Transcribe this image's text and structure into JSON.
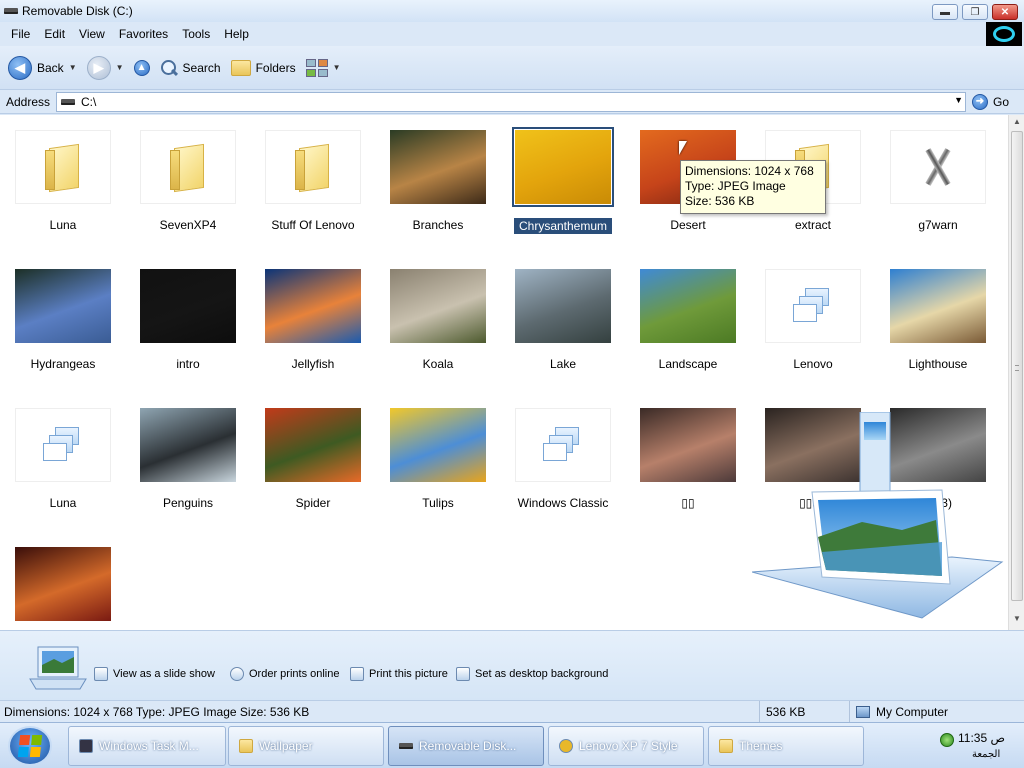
{
  "window": {
    "title": "Removable Disk (C:)",
    "buttons": {
      "minimize": "▬",
      "maximize": "❐",
      "close": "✕"
    }
  },
  "menu": [
    "File",
    "Edit",
    "View",
    "Favorites",
    "Tools",
    "Help"
  ],
  "toolbar": {
    "back": "Back",
    "search": "Search",
    "folders": "Folders"
  },
  "address": {
    "label": "Address",
    "value": "C:\\",
    "go": "Go"
  },
  "items": [
    {
      "name": "Luna",
      "kind": "folder"
    },
    {
      "name": "SevenXP4",
      "kind": "folder"
    },
    {
      "name": "Stuff Of Lenovo",
      "kind": "folder"
    },
    {
      "name": "Branches",
      "kind": "image",
      "colors": [
        "#2a3b24",
        "#b88446",
        "#3d2a18"
      ]
    },
    {
      "name": "Chrysanthemum",
      "kind": "image",
      "colors": [
        "#f0c21a",
        "#e3a40c",
        "#c98b06"
      ],
      "selected": true
    },
    {
      "name": "Desert",
      "kind": "image",
      "colors": [
        "#e36a1e",
        "#c6441a",
        "#7a2412"
      ]
    },
    {
      "name": "extract",
      "kind": "folder"
    },
    {
      "name": "g7warn",
      "kind": "tools"
    },
    {
      "name": "Hydrangeas",
      "kind": "image",
      "colors": [
        "#1c2f26",
        "#5b7fc4",
        "#3a5c94"
      ]
    },
    {
      "name": "intro",
      "kind": "image",
      "colors": [
        "#111111",
        "#151515",
        "#0d0d0d"
      ]
    },
    {
      "name": "Jellyfish",
      "kind": "image",
      "colors": [
        "#0b3478",
        "#e8823a",
        "#1a5bb0"
      ]
    },
    {
      "name": "Koala",
      "kind": "image",
      "colors": [
        "#8a8170",
        "#c9c1af",
        "#4d5a2e"
      ]
    },
    {
      "name": "Lake",
      "kind": "image",
      "colors": [
        "#9fb3c4",
        "#5d6a70",
        "#34403f"
      ]
    },
    {
      "name": "Landscape",
      "kind": "image",
      "colors": [
        "#3f8ad6",
        "#6f9a3a",
        "#4c7a24"
      ]
    },
    {
      "name": "Lenovo",
      "kind": "theme"
    },
    {
      "name": "Lighthouse",
      "kind": "image",
      "colors": [
        "#2e7fd1",
        "#e6d7a8",
        "#7a5a36"
      ]
    },
    {
      "name": "Luna",
      "kind": "theme"
    },
    {
      "name": "Penguins",
      "kind": "image",
      "colors": [
        "#8fa5b2",
        "#2a2f33",
        "#c9d6de"
      ]
    },
    {
      "name": "Spider",
      "kind": "image",
      "colors": [
        "#c23a1a",
        "#3e5a22",
        "#e86a28"
      ]
    },
    {
      "name": "Tulips",
      "kind": "image",
      "colors": [
        "#f2c82a",
        "#4d8ed6",
        "#e8a41c"
      ]
    },
    {
      "name": "Windows Classic",
      "kind": "theme"
    },
    {
      "name": "▯▯",
      "kind": "image",
      "colors": [
        "#3a2a26",
        "#b7806a",
        "#4d3a3a"
      ]
    },
    {
      "name": "▯▯(2)",
      "kind": "image",
      "colors": [
        "#2a2320",
        "#8a7060",
        "#3d3330"
      ]
    },
    {
      "name": "▯▯(3)",
      "kind": "image",
      "colors": [
        "#2a2a2a",
        "#8a8a8a",
        "#444"
      ]
    },
    {
      "name": "",
      "kind": "image",
      "colors": [
        "#3a0e0a",
        "#d46a2a",
        "#7a1a12"
      ]
    }
  ],
  "tooltip": {
    "line1": "Dimensions: 1024 x 768",
    "line2": "Type: JPEG Image",
    "line3": "Size: 536 KB"
  },
  "tasks": [
    {
      "label": "View as a slide show"
    },
    {
      "label": "Order prints online"
    },
    {
      "label": "Print this picture"
    },
    {
      "label": "Set as desktop background"
    }
  ],
  "status": {
    "info": "Dimensions: 1024 x 768 Type: JPEG Image Size: 536 KB",
    "size": "536 KB",
    "zone": "My Computer"
  },
  "taskbar": {
    "buttons": [
      {
        "label": "Windows Task M..."
      },
      {
        "label": "Wallpaper"
      },
      {
        "label": "Removable Disk..."
      },
      {
        "label": "Lenovo XP 7 Style"
      },
      {
        "label": "Themes"
      }
    ],
    "time": "11:35 ص",
    "day": "الجمعة"
  }
}
